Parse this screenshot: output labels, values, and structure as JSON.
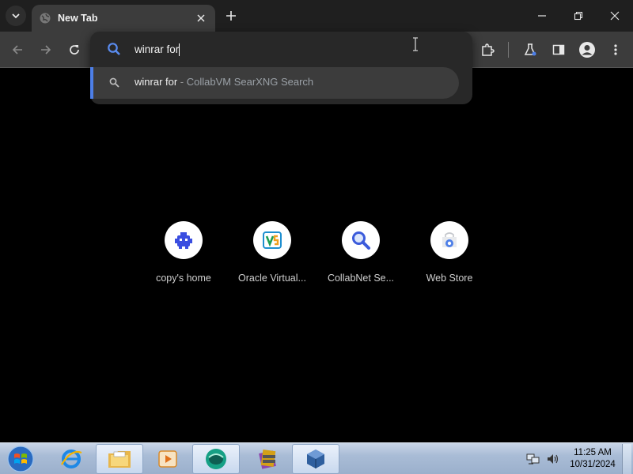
{
  "browser": {
    "tab": {
      "title": "New Tab"
    },
    "omnibox": {
      "input_value": "winrar for",
      "suggestion": {
        "query": "winrar for",
        "separator": " - ",
        "engine": "CollabVM SearXNG Search"
      }
    },
    "shortcuts": [
      {
        "label": "copy's home",
        "icon": "collabvm-bot-icon"
      },
      {
        "label": "Oracle Virtual...",
        "icon": "virtualbox-logo-icon"
      },
      {
        "label": "CollabNet Se...",
        "icon": "magnifier-icon"
      },
      {
        "label": "Web Store",
        "icon": "web-store-icon"
      }
    ],
    "accent_color": "#4d7fe8"
  },
  "taskbar": {
    "apps": [
      "internet-explorer-icon",
      "file-explorer-icon",
      "media-player-icon",
      "browser-icon",
      "winrar-icon",
      "virtualbox-icon"
    ],
    "clock": {
      "time": "11:25 AM",
      "date": "10/31/2024"
    }
  }
}
